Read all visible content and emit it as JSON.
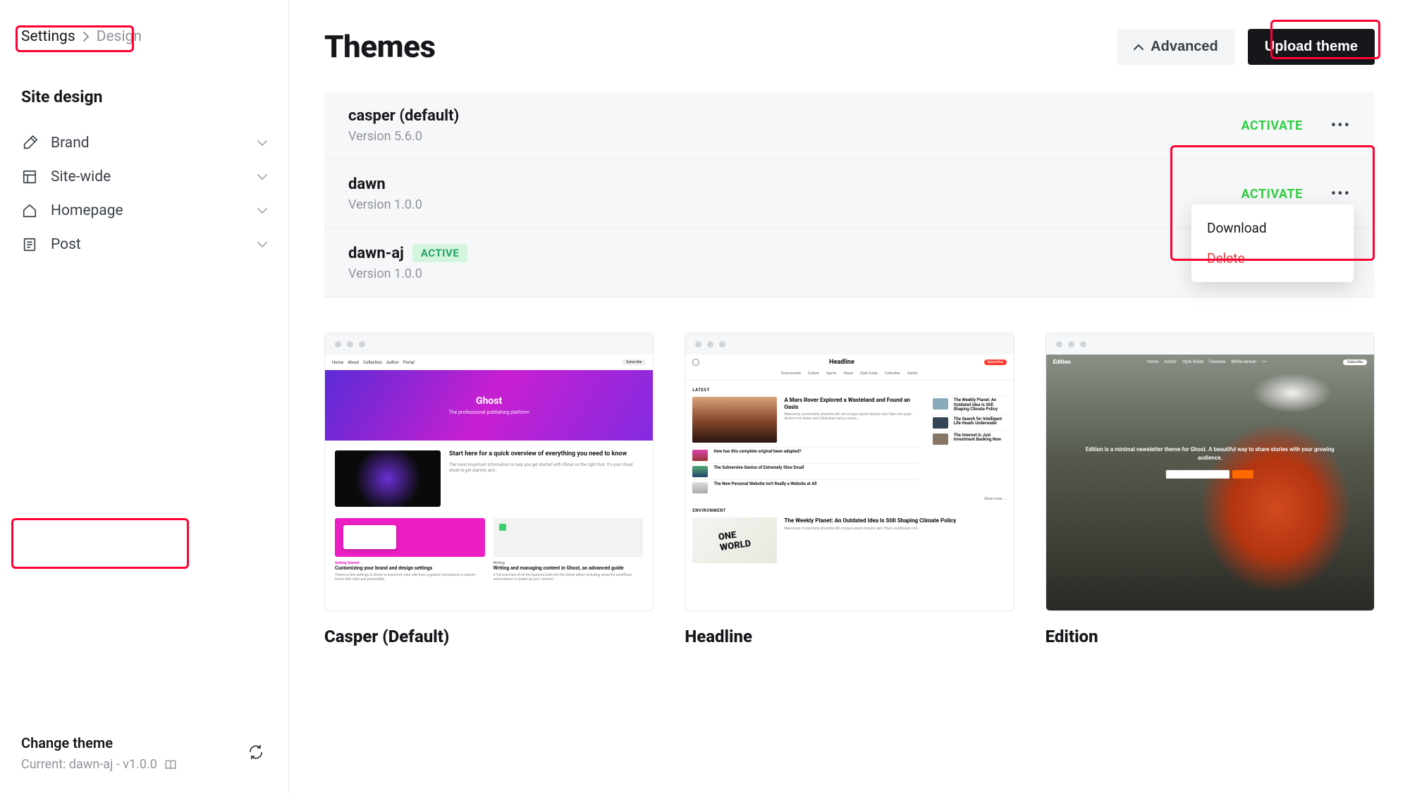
{
  "breadcrumb": {
    "root": "Settings",
    "current": "Design"
  },
  "sidebar": {
    "section_title": "Site design",
    "items": [
      {
        "label": "Brand"
      },
      {
        "label": "Site-wide"
      },
      {
        "label": "Homepage"
      },
      {
        "label": "Post"
      }
    ],
    "footer": {
      "title": "Change theme",
      "subtitle": "Current: dawn-aj - v1.0.0"
    }
  },
  "main": {
    "title": "Themes",
    "advanced_label": "Advanced",
    "upload_label": "Upload theme"
  },
  "themes": [
    {
      "name": "casper (default)",
      "version": "Version 5.6.0",
      "action": "ACTIVATE"
    },
    {
      "name": "dawn",
      "version": "Version 1.0.0",
      "action": "ACTIVATE"
    },
    {
      "name": "dawn-aj",
      "version": "Version 1.0.0",
      "badge": "ACTIVE"
    }
  ],
  "dropdown": {
    "download": "Download",
    "delete": "Delete"
  },
  "previews": [
    {
      "title": "Casper (Default)"
    },
    {
      "title": "Headline"
    },
    {
      "title": "Edition"
    }
  ],
  "preview_content": {
    "casper": {
      "nav": [
        "Home",
        "About",
        "Collection",
        "Author",
        "Portal"
      ],
      "subscribe": "Subscribe",
      "hero_title": "Ghost",
      "hero_sub": "The professional publishing platform",
      "feat_title": "Start here for a quick overview of everything you need to know",
      "feat_sub": "The most important information to help you get started with Ghost on the right foot. It's your cheat sheet to get started, and...",
      "col1_title": "Customizing your brand and design settings",
      "col1_sub": "There's a few settings in Ghost to transform your site from a generic template to a custom brand with style and personality.",
      "col2_title": "Writing and managing content in Ghost, an advanced guide",
      "col2_sub": "A full overview of all the features built into the Ghost editor, including powerful workflows automations to speed up your content..."
    },
    "headline": {
      "title": "Headline",
      "subscribe": "Subscribe",
      "menu": [
        "Environment",
        "Culture",
        "Sports",
        "About",
        "Style Guide",
        "Collection",
        "Author"
      ],
      "latest": "LATEST",
      "h1": "A Mars Rover Explored a Wasteland and Found an Oasis",
      "more": "Show more →",
      "side_items": [
        "The Weekly Planet: An Outdated Idea Is Still Shaping Climate Policy",
        "The Search for Intelligent Life Heads Underwater",
        "The Internet Is Just Investment Banking Now"
      ],
      "list_items": [
        "How has this complete original been adapted?",
        "The Subversive Genius of Extremely Slow Email",
        "The New Personal Website Isn't Really a Website at All"
      ],
      "env": "ENVIRONMENT",
      "h2": "The Weekly Planet: An Outdated Idea Is Still Shaping Climate Policy"
    },
    "edition": {
      "logo": "Edition",
      "nav": [
        "Home",
        "Author",
        "Style Guide",
        "Features",
        "White version"
      ],
      "subscribe": "Subscribe",
      "tagline": "Edition is a minimal newsletter theme for Ghost. A beautiful way to share stories with your growing audience."
    }
  }
}
